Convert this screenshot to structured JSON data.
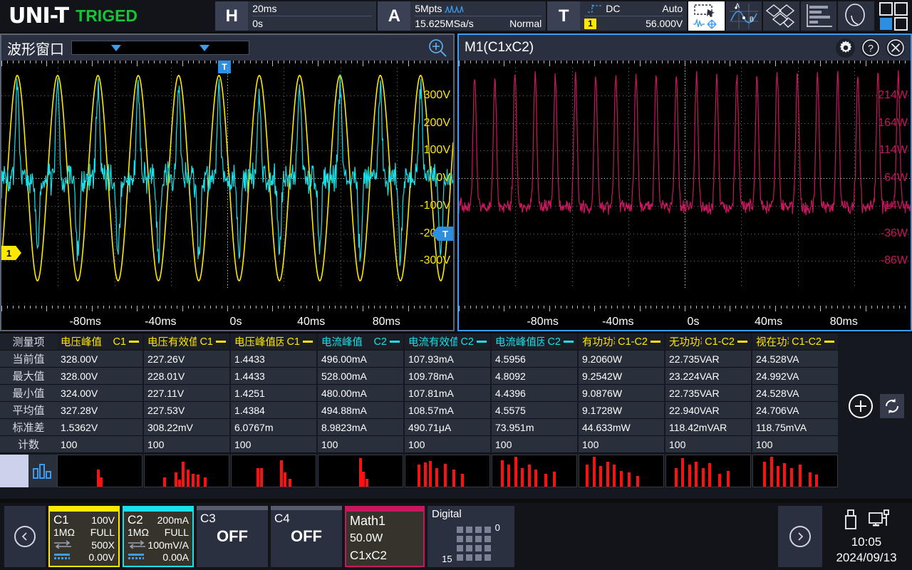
{
  "brand": {
    "logo": "UNI-T",
    "trigger_status": "TRIGED"
  },
  "topbar": {
    "horizontal": {
      "letter": "H",
      "scale": "20ms",
      "position": "0s"
    },
    "acquire": {
      "letter": "A",
      "memory": "5Mpts",
      "samplerate": "15.625MSa/s",
      "mode": "Normal",
      "icon": "waveform-icon"
    },
    "trigger": {
      "letter": "T",
      "coupling": "DC",
      "sweep": "Auto",
      "source": "1",
      "level": "56.000V",
      "icon": "trigger-slope-icon"
    },
    "buttons": [
      {
        "name": "select-move-tool",
        "icon": "select-move-icon",
        "active": true
      },
      {
        "name": "cursor-tool",
        "icon": "cursor-ab-icon",
        "active": false
      },
      {
        "name": "decode-tool",
        "icon": "decode-icon",
        "active": false
      },
      {
        "name": "measure-tool",
        "icon": "bar-measure-icon",
        "active": false
      },
      {
        "name": "search-tool",
        "icon": "magnifier-icon",
        "active": false
      }
    ],
    "layout_button": "grid-layout-icon"
  },
  "left_panel": {
    "title": "波形窗口",
    "zoom_icon": "magnifier-plus-icon",
    "selector_icon": "chevron-down-icon",
    "trigger_marker": "T",
    "channel_marker": "1",
    "y_labels": [
      "300V",
      "200V",
      "100V",
      "0V",
      "-100V",
      "-200V",
      "-300V"
    ],
    "x_labels": [
      "-80ms",
      "-40ms",
      "0s",
      "40ms",
      "80ms"
    ],
    "y_color": "#ffe800",
    "traces": [
      {
        "name": "C1",
        "color": "#ffe800"
      },
      {
        "name": "C2",
        "color": "#19e0e8"
      }
    ]
  },
  "right_panel": {
    "title": "M1(C1xC2)",
    "gear_icon": "gear-icon",
    "help_icon": "question-icon",
    "close_icon": "close-icon",
    "y_labels": [
      "214W",
      "164W",
      "114W",
      "64W",
      "14W",
      "-36W",
      "-86W"
    ],
    "x_labels": [
      "-80ms",
      "-40ms",
      "0s",
      "40ms",
      "80ms"
    ],
    "y_color": "#c7175e",
    "trace_color": "#c7175e"
  },
  "measurements": {
    "row_labels": [
      "测量项",
      "当前值",
      "最大值",
      "最小值",
      "平均值",
      "标准差",
      "计数"
    ],
    "columns": [
      {
        "name": "电压峰值",
        "source": "C1",
        "color": "#ffe800",
        "values": [
          "328.00V",
          "328.00V",
          "324.00V",
          "327.28V",
          "1.5362V",
          "100"
        ],
        "hist": [
          [
            47,
            55
          ],
          [
            50,
            30
          ]
        ]
      },
      {
        "name": "电压有效值",
        "source": "C1",
        "color": "#ffe800",
        "values": [
          "227.26V",
          "228.01V",
          "227.11V",
          "227.53V",
          "308.22mV",
          "100"
        ],
        "hist": [
          [
            22,
            30
          ],
          [
            36,
            45
          ],
          [
            40,
            22
          ],
          [
            44,
            80
          ],
          [
            50,
            55
          ],
          [
            56,
            42
          ],
          [
            62,
            38
          ],
          [
            70,
            30
          ]
        ]
      },
      {
        "name": "电压峰值因数",
        "source": "C1",
        "color": "#ffe800",
        "values": [
          "1.4433",
          "1.4433",
          "1.4251",
          "1.4384",
          "6.0767m",
          "100"
        ],
        "hist": [
          [
            30,
            60
          ],
          [
            34,
            58
          ],
          [
            58,
            85
          ],
          [
            62,
            45
          ],
          [
            68,
            25
          ]
        ]
      },
      {
        "name": "电流峰值",
        "source": "C2",
        "color": "#19e0e8",
        "values": [
          "496.00mA",
          "528.00mA",
          "480.00mA",
          "494.88mA",
          "8.9823mA",
          "100"
        ],
        "hist": [
          [
            48,
            90
          ],
          [
            52,
            48
          ],
          [
            56,
            25
          ]
        ]
      },
      {
        "name": "电流有效值",
        "source": "C2",
        "color": "#19e0e8",
        "values": [
          "107.93mA",
          "109.78mA",
          "107.81mA",
          "108.57mA",
          "490.71μA",
          "100"
        ],
        "hist": [
          [
            14,
            70
          ],
          [
            22,
            78
          ],
          [
            28,
            82
          ],
          [
            36,
            60
          ],
          [
            46,
            72
          ],
          [
            56,
            55
          ],
          [
            66,
            40
          ]
        ]
      },
      {
        "name": "电流峰值因数",
        "source": "C2",
        "color": "#19e0e8",
        "values": [
          "4.5956",
          "4.8092",
          "4.4396",
          "4.5575",
          "73.951m",
          "100"
        ],
        "hist": [
          [
            10,
            85
          ],
          [
            18,
            70
          ],
          [
            26,
            95
          ],
          [
            34,
            60
          ],
          [
            42,
            70
          ],
          [
            50,
            55
          ],
          [
            62,
            40
          ],
          [
            72,
            48
          ]
        ]
      },
      {
        "name": "有功功率",
        "source": "C1-C2",
        "color": "#ffe800",
        "values": [
          "9.2060W",
          "9.2542W",
          "9.0876W",
          "9.1728W",
          "44.633mW",
          "100"
        ],
        "hist": [
          [
            8,
            70
          ],
          [
            16,
            95
          ],
          [
            24,
            65
          ],
          [
            32,
            80
          ],
          [
            40,
            70
          ],
          [
            48,
            50
          ],
          [
            58,
            45
          ],
          [
            68,
            35
          ]
        ]
      },
      {
        "name": "无功功率",
        "source": "C1-C2",
        "color": "#ffe800",
        "values": [
          "22.735VAR",
          "23.224VAR",
          "22.735VAR",
          "22.940VAR",
          "118.42mVAR",
          "100"
        ],
        "hist": [
          [
            10,
            60
          ],
          [
            18,
            90
          ],
          [
            26,
            70
          ],
          [
            34,
            80
          ],
          [
            42,
            60
          ],
          [
            50,
            75
          ],
          [
            62,
            40
          ],
          [
            72,
            50
          ]
        ]
      },
      {
        "name": "视在功率",
        "source": "C1-C2",
        "color": "#ffe800",
        "values": [
          "24.528VA",
          "24.992VA",
          "24.528VA",
          "24.706VA",
          "118.75mVA",
          "100"
        ],
        "hist": [
          [
            12,
            80
          ],
          [
            20,
            95
          ],
          [
            28,
            65
          ],
          [
            36,
            75
          ],
          [
            44,
            60
          ],
          [
            54,
            70
          ],
          [
            66,
            45
          ],
          [
            74,
            38
          ]
        ]
      }
    ],
    "histogram_toggle_icon": "histogram-icon",
    "add_button_icon": "plus-circle-icon",
    "refresh_button_icon": "refresh-icon"
  },
  "bottom": {
    "prev_icon": "chevron-left-icon",
    "next_icon": "chevron-right-icon",
    "channels": [
      {
        "name": "C1",
        "scale": "100V",
        "impedance": "1MΩ",
        "bandwidth": "FULL",
        "probe": "500X",
        "offset": "0.00V",
        "color": "#ffe800",
        "state": "on"
      },
      {
        "name": "C2",
        "scale": "200mA",
        "impedance": "1MΩ",
        "bandwidth": "FULL",
        "probe": "100mV/A",
        "offset": "0.00A",
        "color": "#19e0e8",
        "state": "on"
      },
      {
        "name": "C3",
        "state": "off",
        "status": "OFF"
      },
      {
        "name": "C4",
        "state": "off",
        "status": "OFF"
      }
    ],
    "math": {
      "name": "Math1",
      "scale": "50.0W",
      "expression": "C1xC2",
      "color": "#c7175e"
    },
    "digital": {
      "title": "Digital",
      "top_label": "0",
      "bottom_label": "15"
    },
    "status": {
      "usb_icon": "usb-icon",
      "lan_icon": "lan-icon",
      "time": "10:05",
      "date": "2024/09/13"
    }
  }
}
